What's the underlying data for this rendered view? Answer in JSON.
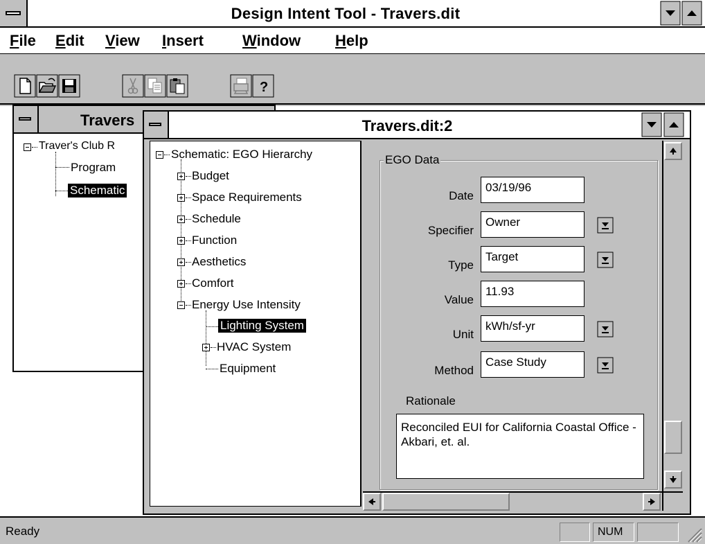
{
  "app": {
    "title": "Design Intent Tool - Travers.dit"
  },
  "menu": [
    {
      "mnemonic": "F",
      "rest": "ile"
    },
    {
      "mnemonic": "E",
      "rest": "dit"
    },
    {
      "mnemonic": "V",
      "rest": "iew"
    },
    {
      "mnemonic": "I",
      "rest": "nsert"
    },
    {
      "mnemonic": "W",
      "rest": "indow"
    },
    {
      "mnemonic": "H",
      "rest": "elp"
    }
  ],
  "toolbar": {
    "icons": [
      "new-file-icon",
      "open-folder-icon",
      "save-disk-icon",
      "cut-scissors-icon",
      "copy-icon",
      "paste-icon",
      "print-icon",
      "help-question-icon"
    ]
  },
  "back_window": {
    "title": "Travers",
    "tree": {
      "root": "Traver's Club R",
      "children": [
        "Program",
        "Schematic"
      ]
    }
  },
  "front_window": {
    "title": "Travers.dit:2",
    "tree": {
      "root": "Schematic: EGO Hierarchy",
      "items": [
        "Budget",
        "Space Requirements",
        "Schedule",
        "Function",
        "Aesthetics",
        "Comfort",
        "Energy Use Intensity"
      ],
      "sub_items": [
        "Lighting System",
        "HVAC System",
        "Equipment"
      ]
    },
    "ego": {
      "group_label": "EGO Data",
      "date_label": "Date",
      "date_value": "03/19/96",
      "specifier_label": "Specifier",
      "specifier_value": "Owner",
      "type_label": "Type",
      "type_value": "Target",
      "value_label": "Value",
      "value_value": "11.93",
      "unit_label": "Unit",
      "unit_value": "kWh/sf-yr",
      "method_label": "Method",
      "method_value": "Case Study",
      "rationale_label": "Rationale",
      "rationale_text": "Reconciled EUI for California Coastal Office - Akbari, et. al."
    }
  },
  "status": {
    "text": "Ready",
    "num_indicator": "NUM"
  },
  "colors": {
    "face": "#c0c0c0",
    "selection": "#000000",
    "window": "#ffffff"
  }
}
